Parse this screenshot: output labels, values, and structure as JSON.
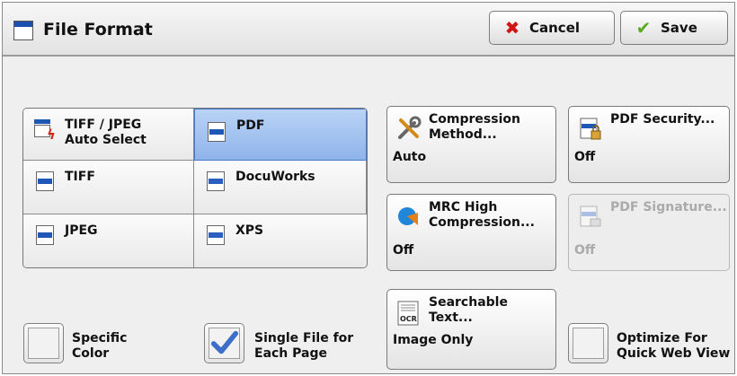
{
  "header": {
    "title": "File Format",
    "cancel_label": "Cancel",
    "save_label": "Save"
  },
  "formats": [
    {
      "label_line1": "TIFF / JPEG",
      "label_line2": "Auto Select",
      "selected": false,
      "icon": "tiff-jpeg-auto-icon"
    },
    {
      "label_line1": "PDF",
      "label_line2": "",
      "selected": true,
      "icon": "pdf-doc-icon"
    },
    {
      "label_line1": "TIFF",
      "label_line2": "",
      "selected": false,
      "icon": "tiff-doc-icon"
    },
    {
      "label_line1": "DocuWorks",
      "label_line2": "",
      "selected": false,
      "icon": "docuworks-doc-icon"
    },
    {
      "label_line1": "JPEG",
      "label_line2": "",
      "selected": false,
      "icon": "jpeg-doc-icon"
    },
    {
      "label_line1": "XPS",
      "label_line2": "",
      "selected": false,
      "icon": "xps-doc-icon"
    }
  ],
  "options": {
    "compression": {
      "line1": "Compression",
      "line2": "Method...",
      "value": "Auto",
      "enabled": true
    },
    "pdf_security": {
      "line1": "PDF Security...",
      "value": "Off",
      "enabled": true
    },
    "mrc": {
      "line1": "MRC High",
      "line2": "Compression...",
      "value": "Off",
      "enabled": true
    },
    "pdf_signature": {
      "line1": "PDF Signature...",
      "value": "Off",
      "enabled": false
    },
    "searchable": {
      "line1": "Searchable",
      "line2": "Text...",
      "value": "Image Only",
      "enabled": true
    }
  },
  "checkboxes": {
    "specific_color": {
      "line1": "Specific",
      "line2": "Color",
      "checked": false
    },
    "single_file": {
      "line1": "Single File for",
      "line2": "Each Page",
      "checked": true
    },
    "optimize": {
      "line1": "Optimize For",
      "line2": "Quick Web View",
      "checked": false
    }
  },
  "colors": {
    "selected_bg": "#9cbcee",
    "accent_blue": "#1e58b6",
    "cancel_red": "#d01515",
    "save_green": "#5cab1e"
  }
}
